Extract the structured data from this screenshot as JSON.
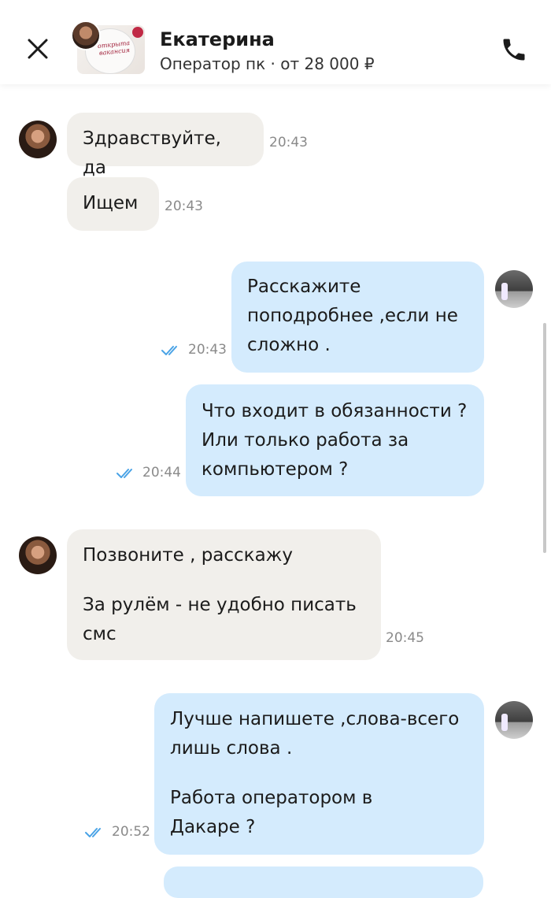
{
  "header": {
    "contact_name": "Екатерина",
    "subtitle": "Оператор пк · от 28 000 ₽",
    "ad_thumb_text": "открыта вакансия",
    "close_icon": "close-icon",
    "phone_icon": "phone-icon"
  },
  "colors": {
    "incoming_bubble": "#f1efeb",
    "outgoing_bubble": "#d4ebfd",
    "read_ticks": "#4aa3e6",
    "timestamp": "#8a8a8a"
  },
  "messages": [
    {
      "direction": "in",
      "lines": [
        "Здравствуйте, да"
      ],
      "time": "20:43"
    },
    {
      "direction": "in",
      "lines": [
        "Ищем"
      ],
      "time": "20:43"
    },
    {
      "direction": "out",
      "lines": [
        "Расскажите",
        "поподробнее ,если не",
        "сложно ."
      ],
      "time": "20:43",
      "read": true
    },
    {
      "direction": "out",
      "lines": [
        "Что входит в обязанности ?",
        "Или только работа за",
        "компьютером ?"
      ],
      "time": "20:44",
      "read": true
    },
    {
      "direction": "in",
      "paragraphs": [
        [
          "Позвоните , расскажу"
        ],
        [
          "За рулём - не удобно писать",
          "смс"
        ]
      ],
      "time": "20:45"
    },
    {
      "direction": "out",
      "paragraphs": [
        [
          "Лучше напишете ,слова-всего",
          "лишь слова ."
        ],
        [
          "Работа оператором в",
          "Дакаре ?"
        ]
      ],
      "time": "20:52",
      "read": true
    }
  ]
}
